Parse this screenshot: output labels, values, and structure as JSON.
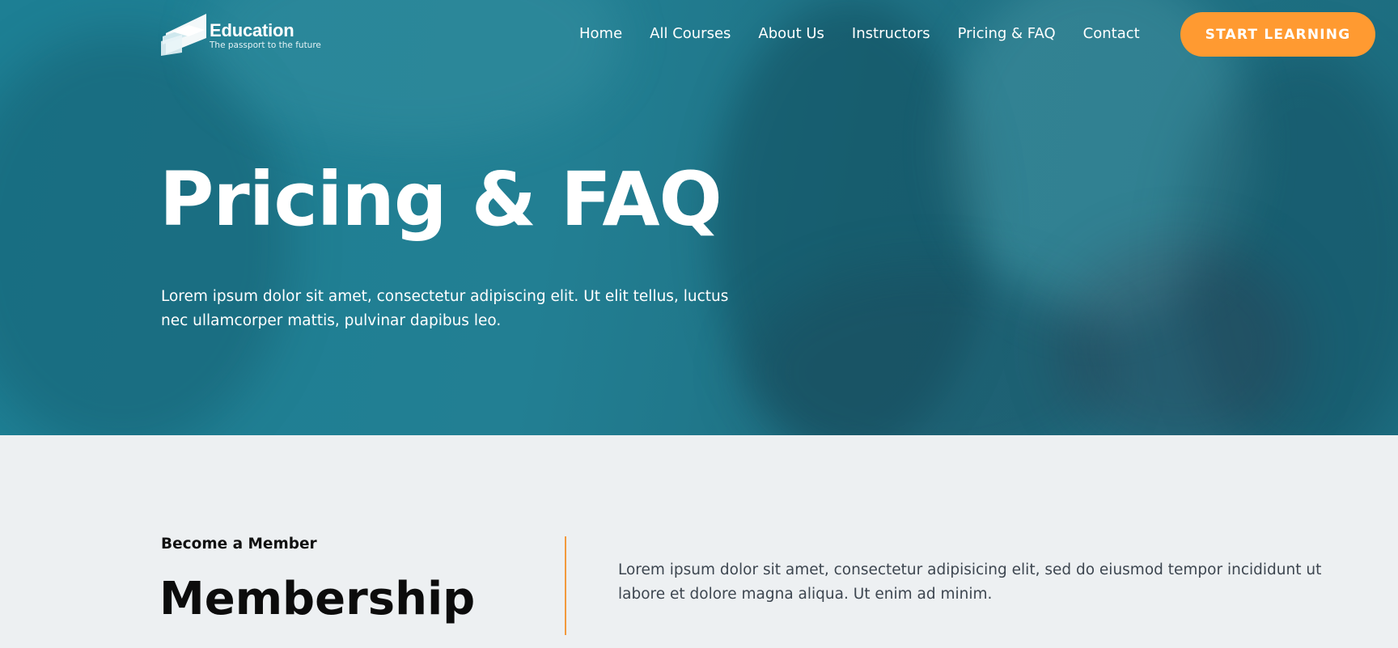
{
  "brand": {
    "name": "Education",
    "tagline": "The passport to the future"
  },
  "nav": {
    "items": [
      "Home",
      "All Courses",
      "About Us",
      "Instructors",
      "Pricing & FAQ",
      "Contact"
    ],
    "cta_label": "START LEARNING"
  },
  "hero": {
    "title": "Pricing & FAQ",
    "text": "Lorem ipsum dolor sit amet, consectetur adipiscing elit. Ut elit tellus, luctus nec ullamcorper mattis, pulvinar dapibus leo."
  },
  "membership": {
    "eyebrow": "Become a Member",
    "title": "Membership",
    "text": "Lorem ipsum dolor sit amet, consectetur adipisicing elit, sed do eiusmod tempor incididunt ut labore et dolore magna aliqua. Ut enim ad minim."
  },
  "colors": {
    "hero_overlay": "#1d7f94",
    "accent": "#ff9a31",
    "section_bg": "#edf0f2",
    "divider": "#f29a3e"
  }
}
